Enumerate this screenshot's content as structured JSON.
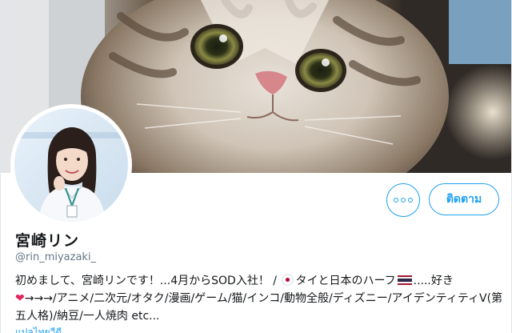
{
  "profile": {
    "name": "宮崎リン",
    "handle": "@rin_miyazaki_",
    "bio_part1": "初めまして、宮崎リンです！...4月からSOD入社！ / ",
    "bio_part2": "タイと日本のハーフ",
    "bio_part3": ".....好き",
    "bio_part4": "→→→/アニメ/二次元/オタク/漫画/ゲーム/猫/インコ/動物全般/ディズニー/アイデンティティV(第五人格)/納豆/一人焼肉 etc...",
    "cut_text": "แปลไทยวีดี"
  },
  "actions": {
    "more_label": "more",
    "follow_label": "ติดตาม"
  },
  "colors": {
    "accent": "#1da1f2",
    "heart": "#e0245e"
  },
  "icons": {
    "more": "more-dots-icon",
    "heart": "heart-icon",
    "flag_japan": "japan-flag-icon",
    "flag_thailand": "thailand-flag-icon"
  }
}
